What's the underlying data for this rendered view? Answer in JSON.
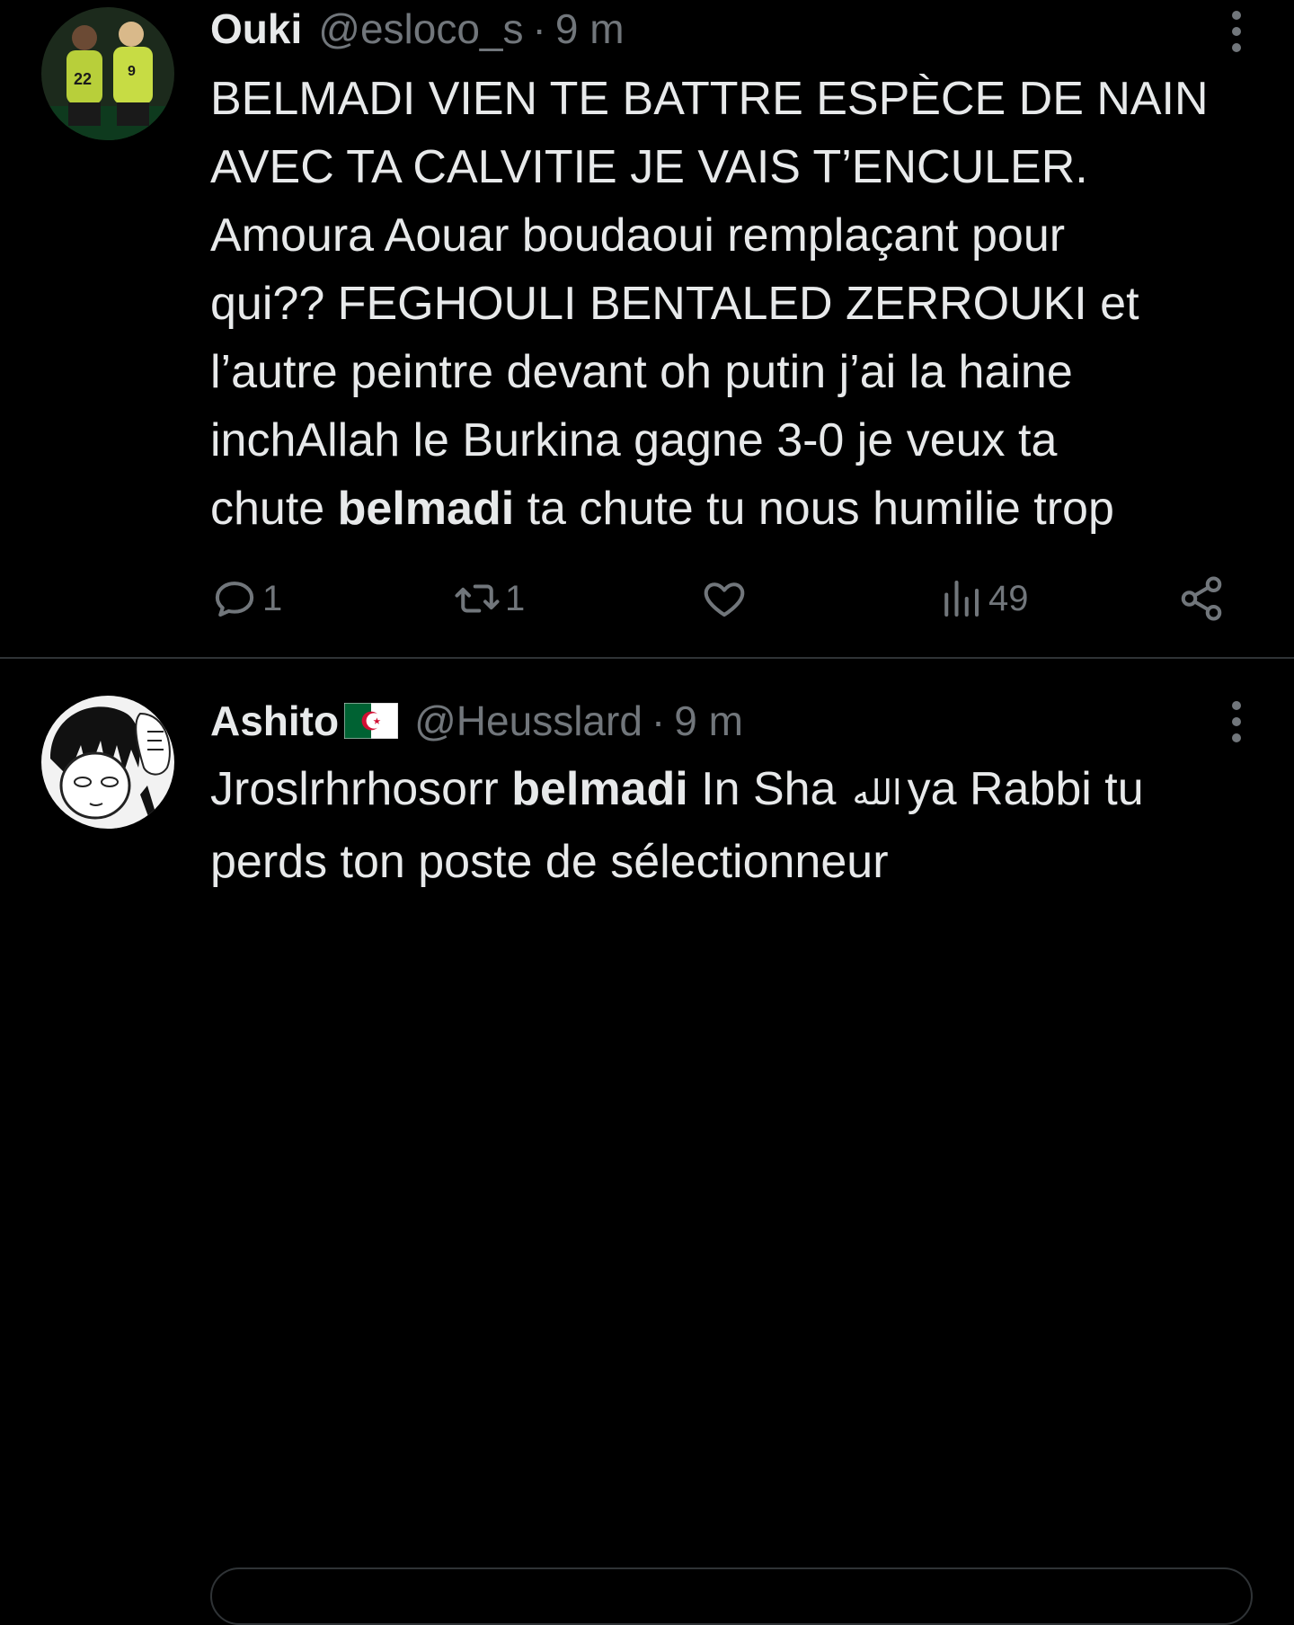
{
  "tweets": [
    {
      "display_name": "Ouki",
      "handle": "@esloco_s",
      "separator": "·",
      "time": "9 m",
      "avatar_icon": "football-players-avatar-icon",
      "body_lines": [
        "BELMADI VIEN TE BATTRE ESPÈCE DE NAIN",
        "AVEC TA CALVITIE JE VAIS T’ENCULER.",
        "Amoura Aouar boudaoui remplaçant pour",
        "qui?? FEGHOULI BENTALED ZERROUKI et",
        "l’autre peintre devant oh putin j’ai la haine",
        "inchAllah le Burkina gagne 3-0 je veux ta"
      ],
      "last_line": {
        "before": "chute ",
        "bold": "belmadi",
        "after": " ta chute tu nous humilie trop"
      },
      "actions": {
        "reply_count": "1",
        "retweet_count": "1",
        "like_count": "",
        "views_count": "49"
      }
    },
    {
      "display_name": "Ashito",
      "flag_icon": "algeria-flag-icon",
      "handle": "@Heusslard",
      "separator": "·",
      "time": "9 m",
      "avatar_icon": "manga-character-avatar-icon",
      "line1": {
        "before": "Jroslrhrhosorr ",
        "bold": "belmadi",
        "middle": " In Sha",
        "arabic": "الله",
        "after": "ya Rabbi tu"
      },
      "line2": "perds ton poste de sélectionneur"
    }
  ],
  "colors": {
    "background": "#000000",
    "primary_text": "#e7e9ea",
    "secondary_text": "#71767b",
    "divider": "#2f3336"
  }
}
